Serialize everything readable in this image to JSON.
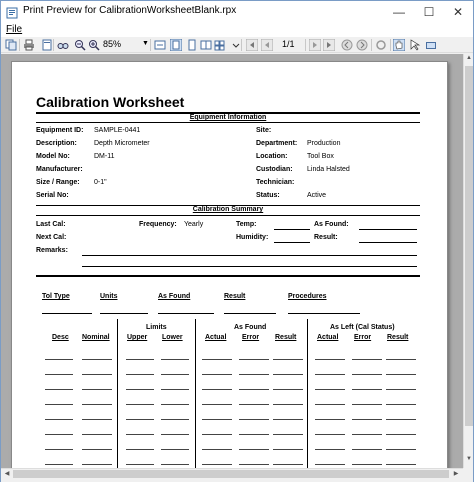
{
  "window": {
    "title": "Print Preview for CalibrationWorksheetBlank.rpx",
    "minimize": "—",
    "maximize": "☐",
    "close": "✕"
  },
  "menu": {
    "file": "File"
  },
  "toolbar": {
    "zoom": "85%",
    "page": "1/1"
  },
  "doc": {
    "title": "Calibration Worksheet",
    "equip_section": "Equipment Information",
    "fields_left": [
      {
        "label": "Equipment ID:",
        "value": "SAMPLE-0441"
      },
      {
        "label": "Description:",
        "value": "Depth Micrometer"
      },
      {
        "label": "Model No:",
        "value": "DM-11"
      },
      {
        "label": "Manufacturer:",
        "value": ""
      },
      {
        "label": "Size / Range:",
        "value": "0-1\""
      },
      {
        "label": "Serial No:",
        "value": ""
      }
    ],
    "fields_right": [
      {
        "label": "Site:",
        "value": ""
      },
      {
        "label": "Department:",
        "value": "Production"
      },
      {
        "label": "Location:",
        "value": "Tool Box"
      },
      {
        "label": "Custodian:",
        "value": "Linda Halsted"
      },
      {
        "label": "Technician:",
        "value": ""
      },
      {
        "label": "Status:",
        "value": "Active"
      }
    ],
    "cal_section": "Calibration Summary",
    "last_cal": "Last Cal:",
    "next_cal": "Next Cal:",
    "remarks": "Remarks:",
    "frequency_label": "Frequency:",
    "frequency_value": "Yearly",
    "temp": "Temp:",
    "humidity": "Humidity:",
    "as_found": "As Found:",
    "result": "Result:",
    "top_headers": [
      "Tol Type",
      "Units",
      "As Found",
      "Result",
      "Procedures"
    ],
    "group_limits": "Limits",
    "group_as_found": "As Found",
    "group_as_left": "As Left (Cal Status)",
    "col_headers": [
      "Desc",
      "Nominal",
      "Upper",
      "Lower",
      "Actual",
      "Error",
      "Result",
      "Actual",
      "Error",
      "Result"
    ]
  }
}
